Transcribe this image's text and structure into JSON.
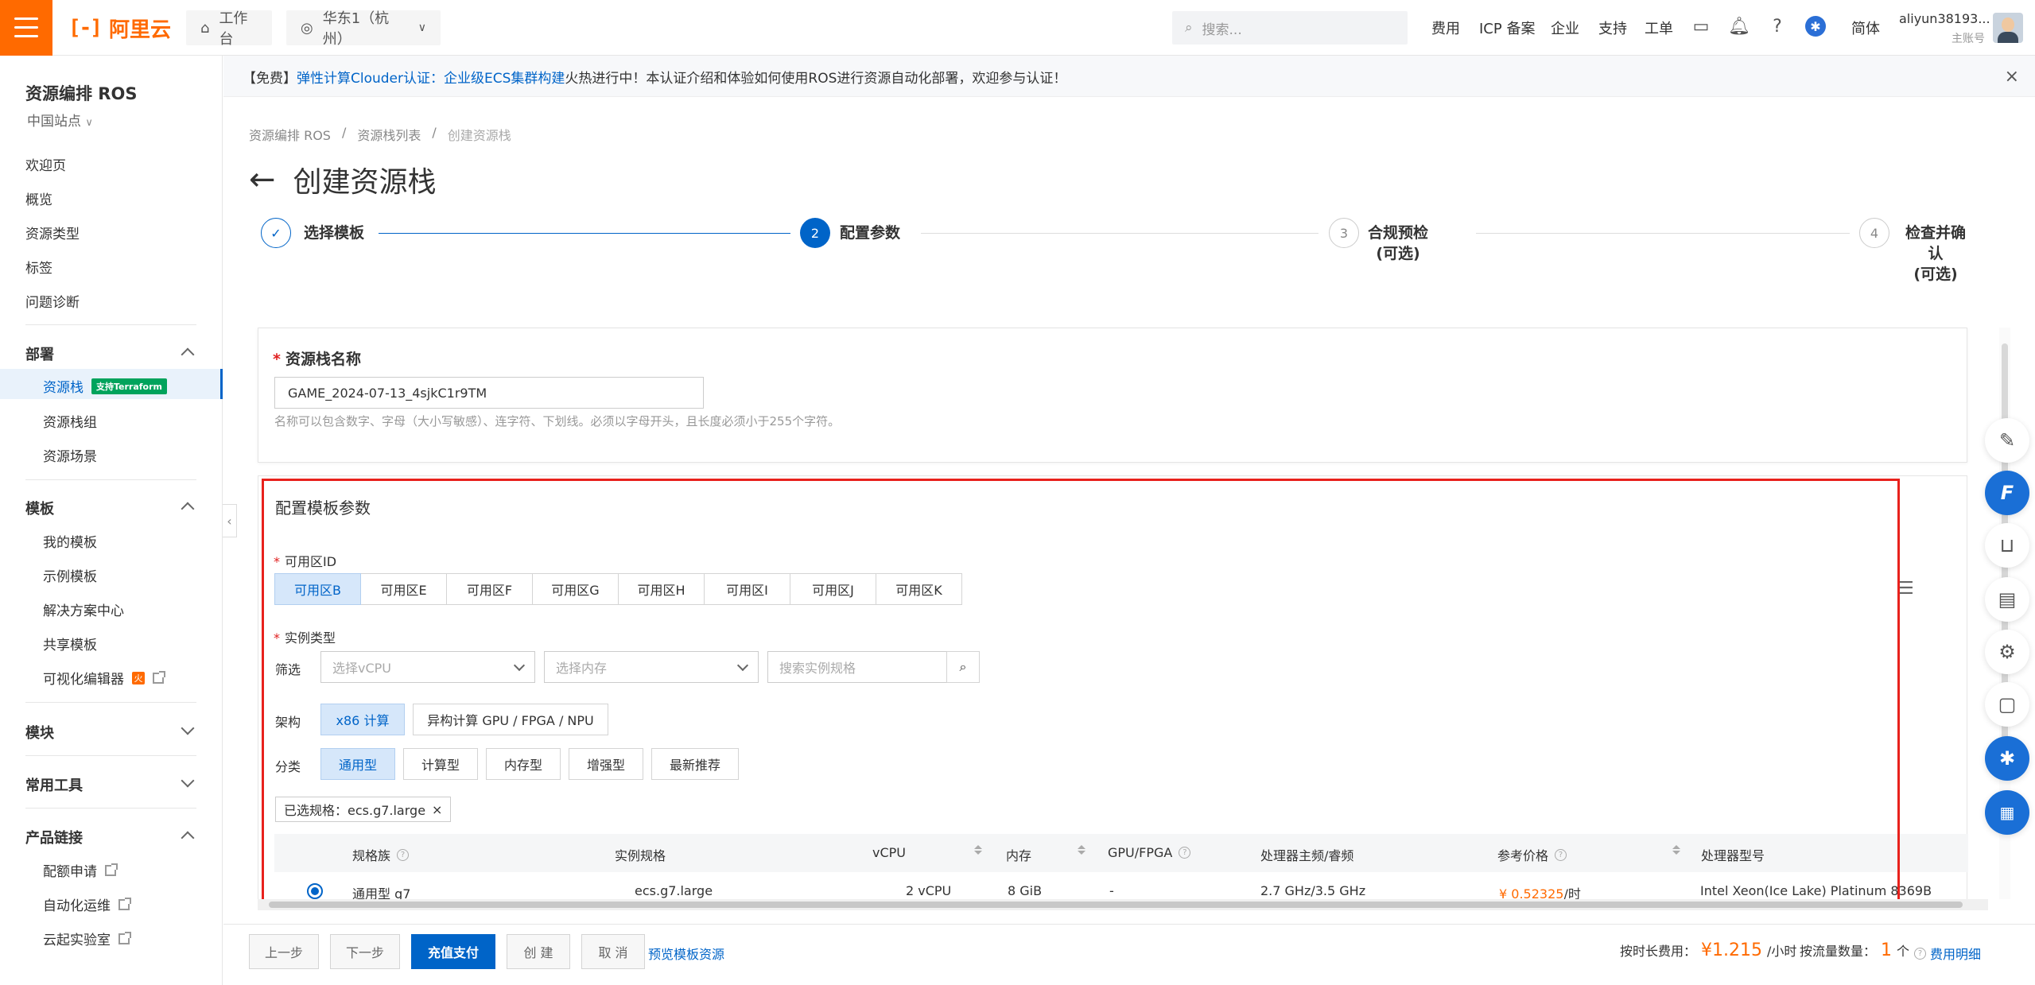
{
  "topbar": {
    "logo_text": "阿里云",
    "workbench": "工作台",
    "region": "华东1（杭州）",
    "search_placeholder": "搜索...",
    "nav": [
      "费用",
      "ICP 备案",
      "企业",
      "支持",
      "工单"
    ],
    "lang": "简体",
    "user_name": "aliyun38193...",
    "user_role": "主账号"
  },
  "banner": {
    "prefix": "【免费】",
    "link1": "弹性计算Clouder认证：",
    "link2": "企业级ECS集群构建",
    "text": "火热进行中！本认证介绍和体验如何使用ROS进行资源自动化部署，欢迎参与认证！"
  },
  "sidebar": {
    "title": "资源编排 ROS",
    "site": "中国站点",
    "items": [
      "欢迎页",
      "概览",
      "资源类型",
      "标签",
      "问题诊断"
    ],
    "group_deploy": "部署",
    "deploy_items": [
      "资源栈",
      "资源栈组",
      "资源场景"
    ],
    "terraform_badge": "支持Terraform",
    "group_template": "模板",
    "template_items": [
      "我的模板",
      "示例模板",
      "解决方案中心",
      "共享模板",
      "可视化编辑器"
    ],
    "group_module": "模块",
    "group_tools": "常用工具",
    "group_links": "产品链接",
    "link_items": [
      "配额申请",
      "自动化运维",
      "云起实验室"
    ]
  },
  "breadcrumb": [
    "资源编排 ROS",
    "资源栈列表",
    "创建资源栈"
  ],
  "page_title": "创建资源栈",
  "steps": [
    {
      "num": "✓",
      "label": "选择模板"
    },
    {
      "num": "2",
      "label": "配置参数"
    },
    {
      "num": "3",
      "label": "合规预检",
      "sub": "(可选)"
    },
    {
      "num": "4",
      "label": "检查并确认",
      "sub": "(可选)"
    }
  ],
  "stack_name": {
    "label": "资源栈名称",
    "value": "GAME_2024-07-13_4sjkC1r9TM",
    "hint": "名称可以包含数字、字母（大小写敏感）、连字符、下划线。必须以字母开头，且长度必须小于255个字符。"
  },
  "params": {
    "title": "配置模板参数",
    "zone_label": "可用区ID",
    "zones": [
      "可用区B",
      "可用区E",
      "可用区F",
      "可用区G",
      "可用区H",
      "可用区I",
      "可用区J",
      "可用区K"
    ],
    "instance_type_label": "实例类型",
    "filter_label": "筛选",
    "vcpu_placeholder": "选择vCPU",
    "memory_placeholder": "选择内存",
    "search_placeholder": "搜索实例规格",
    "arch_label": "架构",
    "arch_options": [
      "x86 计算",
      "异构计算 GPU / FPGA / NPU"
    ],
    "category_label": "分类",
    "categories": [
      "通用型",
      "计算型",
      "内存型",
      "增强型",
      "最新推荐"
    ],
    "selected_tag": "已选规格：ecs.g7.large"
  },
  "table": {
    "headers": [
      "规格族",
      "实例规格",
      "vCPU",
      "内存",
      "GPU/FPGA",
      "处理器主频/睿频",
      "参考价格",
      "处理器型号"
    ],
    "row": {
      "family": "通用型 g7",
      "spec": "ecs.g7.large",
      "vcpu": "2 vCPU",
      "memory": "8 GiB",
      "gpu": "-",
      "freq": "2.7 GHz/3.5 GHz",
      "price": "¥ 0.52325",
      "price_unit": "/时",
      "cpu_model": "Intel Xeon(Ice Lake) Platinum 8369B"
    }
  },
  "footer": {
    "prev": "上一步",
    "next": "下一步",
    "pay": "充值支付",
    "create": "创 建",
    "cancel": "取 消",
    "preview": "预览模板资源",
    "fee_label": "按时长费用：",
    "fee_value": "¥1.215",
    "fee_unit": "/小时",
    "flow_label": "按流量数量：",
    "flow_value": "1",
    "flow_unit": "个",
    "fee_detail": "费用明细"
  },
  "colors": {
    "brand": "#ff6a00",
    "primary": "#0064c8",
    "highlight": "#e8211c"
  }
}
